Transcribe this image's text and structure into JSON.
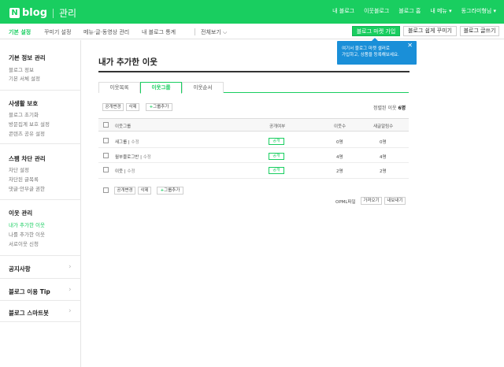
{
  "brand": {
    "n": "N",
    "blog": "blog",
    "admin": "관리"
  },
  "topnav": [
    "내 블로그",
    "이웃블로그",
    "블로그 홈",
    "내 메뉴 ▾",
    "동그라미형님 ▾"
  ],
  "subnav": {
    "tabs": [
      "기본 설정",
      "꾸미기 설정",
      "메뉴·글·동영상 관리",
      "내 블로그 통계"
    ],
    "view_all": "전체보기 ⌵",
    "market_btn": "블로그 마켓 가입",
    "easy_decorate": "블로그 쉽게 꾸미기",
    "write": "블로그 글쓰기"
  },
  "tooltip": {
    "line1": "여기서 블로그 마켓 셀러로",
    "line2": "가입하고, 상품을 등록해보세요.",
    "close": "✕"
  },
  "sidebar": {
    "s1": {
      "title": "기본 정보 관리",
      "items": [
        "블로그 정보",
        "기본 서체 설정"
      ]
    },
    "s2": {
      "title": "사생활 보호",
      "items": [
        "블로그 초기화",
        "방문집계 보호 설정",
        "콘텐츠 공유 설정"
      ]
    },
    "s3": {
      "title": "스팸 차단 관리",
      "items": [
        "차단 설정",
        "차단된 글목록",
        "댓글·안부글 권한"
      ]
    },
    "s4": {
      "title": "이웃 관리",
      "items": [
        "내가 추가한 이웃",
        "나를 추가한 이웃",
        "서로이웃 신청"
      ]
    },
    "s5": {
      "title": "공지사항"
    },
    "s6": {
      "title": "블로그 이용 Tip"
    },
    "s7": {
      "title": "블로그 스마트봇"
    }
  },
  "main": {
    "title": "내가 추가한 이웃",
    "tabs": [
      "이웃목록",
      "이웃그룹",
      "이웃순서"
    ],
    "toolbar": {
      "public_change": "공개변경",
      "delete": "삭제",
      "add_group": "그룹추가"
    },
    "summary_prefix": "정렬된 이웃",
    "summary_count": "6명",
    "columns": [
      "이웃그룹",
      "공개여부",
      "이웃수",
      "새글알림수"
    ],
    "rows": [
      {
        "name": "새그룹",
        "edit": "수정",
        "status": "공개",
        "count": "0명",
        "alerts": "0명"
      },
      {
        "name": "월부블로그반",
        "edit": "수정",
        "status": "공개",
        "count": "4명",
        "alerts": "4명"
      },
      {
        "name": "이웃",
        "edit": "수정",
        "status": "공개",
        "count": "2명",
        "alerts": "2명"
      }
    ],
    "opml": {
      "label": "OPML파일",
      "import": "가져오기",
      "export": "내보내기"
    }
  }
}
